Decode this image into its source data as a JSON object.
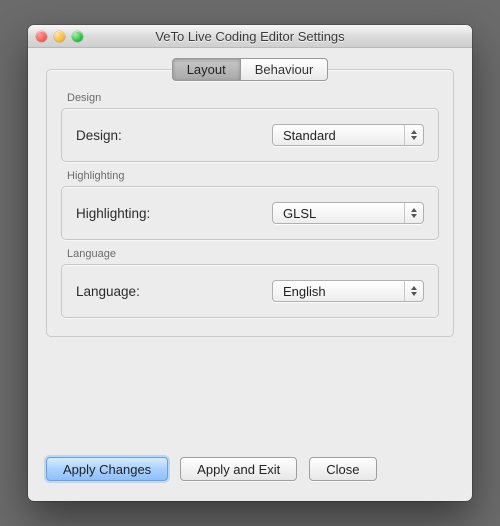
{
  "window": {
    "title": "VeTo Live Coding Editor Settings"
  },
  "tabs": {
    "layout": "Layout",
    "behaviour": "Behaviour",
    "active": "layout"
  },
  "groups": {
    "design": {
      "caption": "Design",
      "label": "Design:",
      "value": "Standard"
    },
    "highlighting": {
      "caption": "Highlighting",
      "label": "Highlighting:",
      "value": "GLSL"
    },
    "language": {
      "caption": "Language",
      "label": "Language:",
      "value": "English"
    }
  },
  "buttons": {
    "apply_changes": "Apply Changes",
    "apply_and_exit": "Apply and Exit",
    "close": "Close"
  }
}
